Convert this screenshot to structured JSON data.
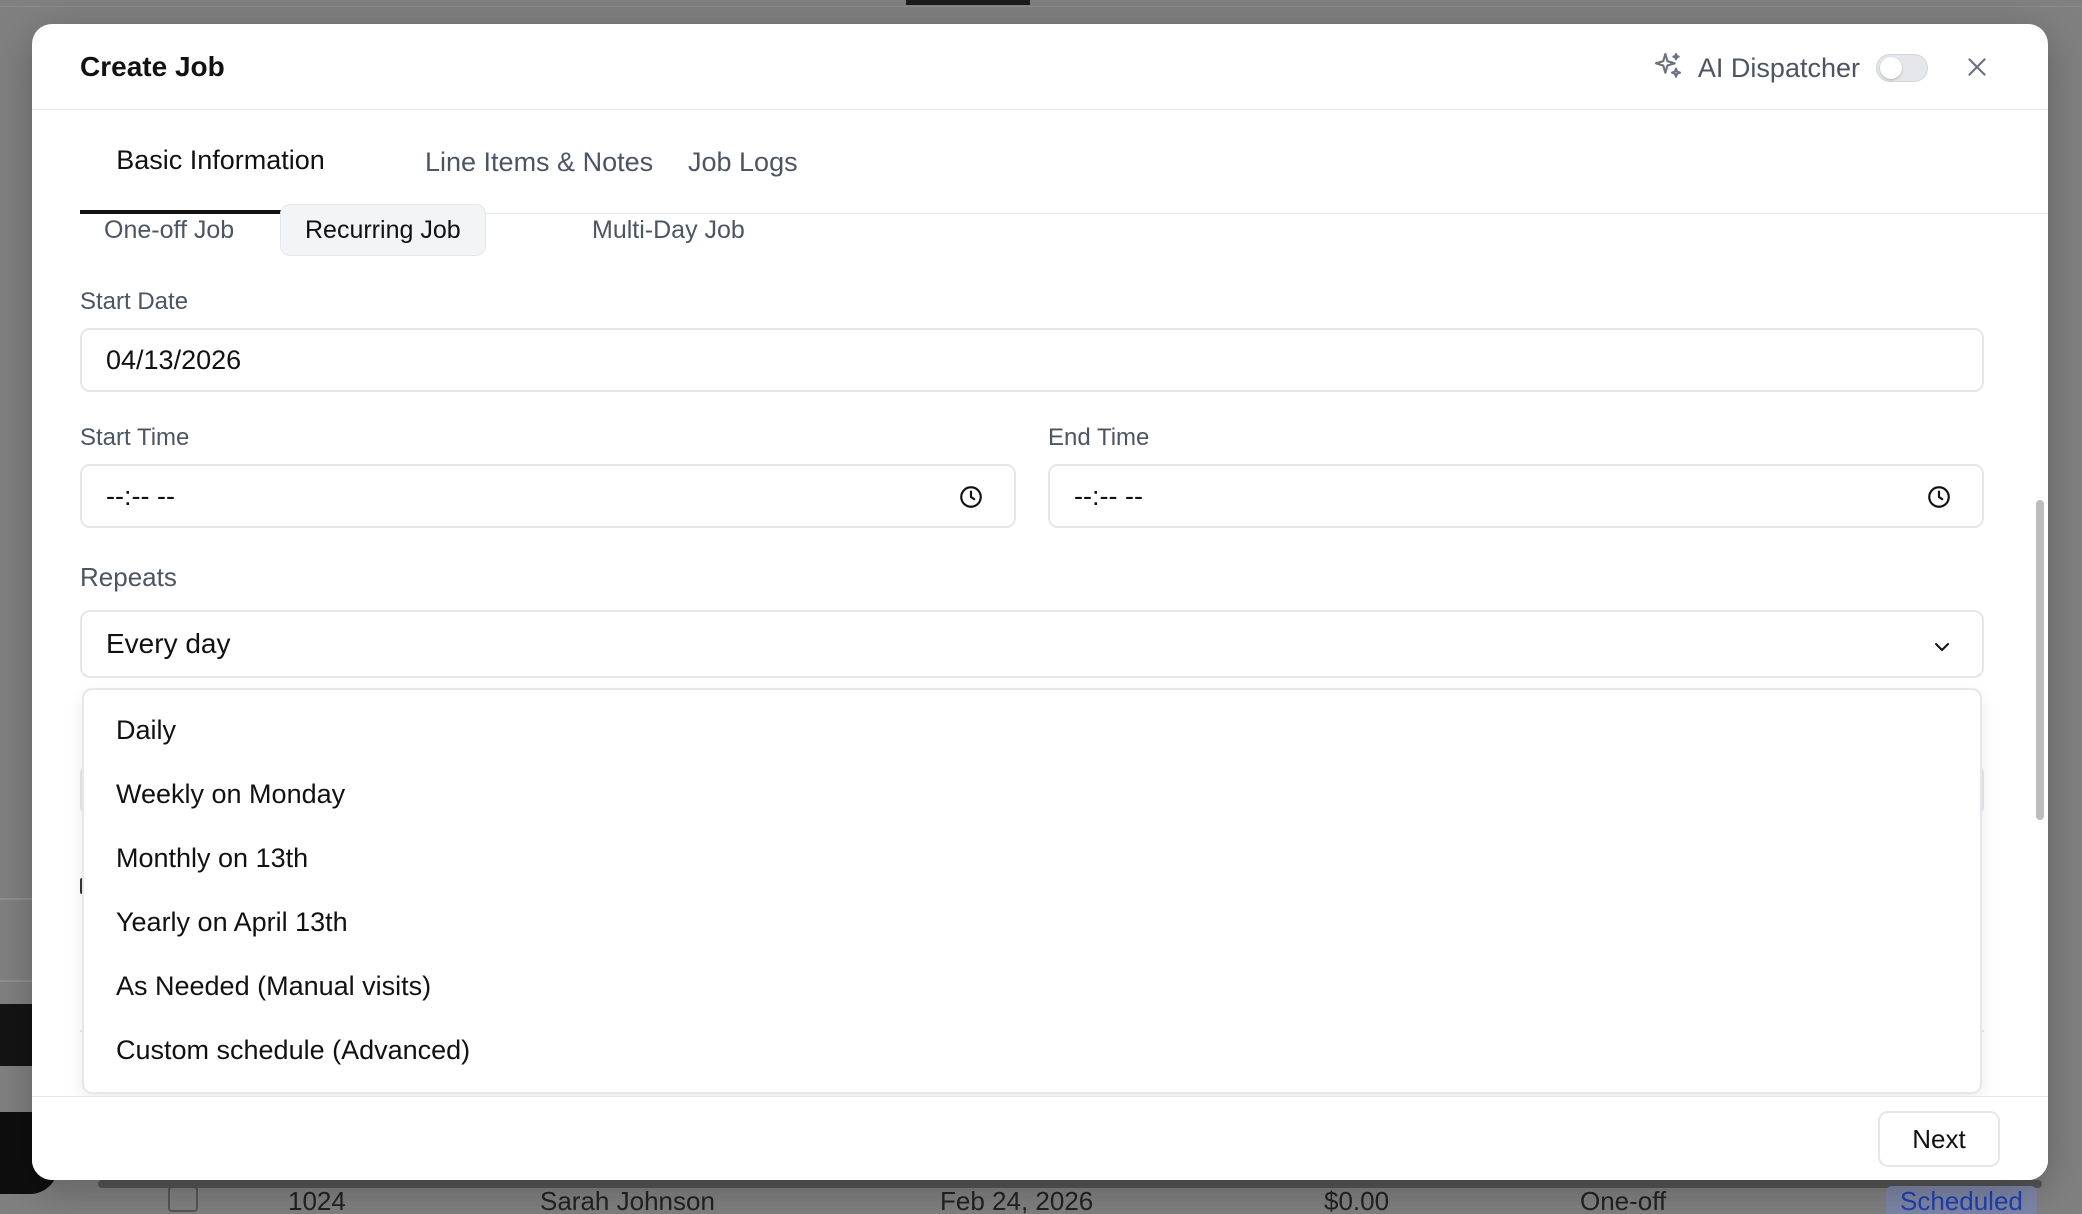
{
  "background": {
    "row": {
      "id": "1024",
      "customer": "Sarah Johnson",
      "date": "Feb 24, 2026",
      "amount": "$0.00",
      "type": "One-off",
      "status": "Scheduled"
    }
  },
  "modal": {
    "title": "Create Job",
    "ai_dispatcher": {
      "label": "AI Dispatcher",
      "enabled": false
    },
    "tabs": [
      {
        "label": "Basic Information",
        "active": true
      },
      {
        "label": "Line Items & Notes",
        "active": false
      },
      {
        "label": "Job Logs",
        "active": false
      }
    ],
    "job_types": [
      {
        "label": "One-off Job",
        "selected": false
      },
      {
        "label": "Recurring Job",
        "selected": true
      },
      {
        "label": "Multi-Day Job",
        "selected": false
      }
    ],
    "start_date": {
      "label": "Start Date",
      "value": "04/13/2026"
    },
    "start_time": {
      "label": "Start Time",
      "value": "--:-- --"
    },
    "end_time": {
      "label": "End Time",
      "value": "--:-- --"
    },
    "repeats": {
      "label": "Repeats",
      "value": "Every day",
      "options": [
        "Daily",
        "Weekly on Monday",
        "Monthly on 13th",
        "Yearly on April 13th",
        "As Needed (Manual visits)",
        "Custom schedule (Advanced)"
      ]
    },
    "footer": {
      "next_label": "Next"
    }
  }
}
